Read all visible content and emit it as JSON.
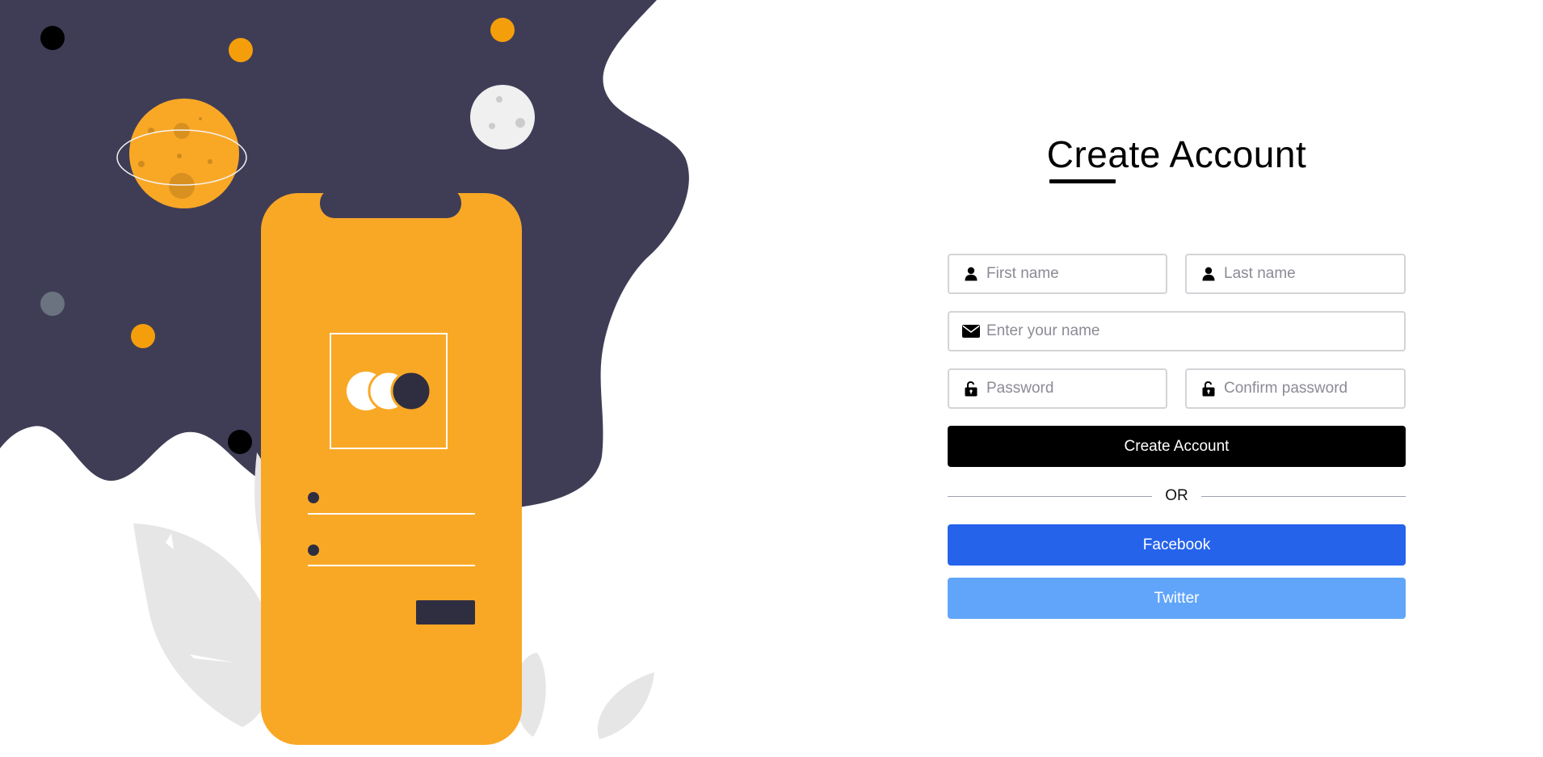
{
  "form": {
    "title": "Create Account",
    "first_name_placeholder": "First name",
    "last_name_placeholder": "Last name",
    "email_placeholder": "Enter your name",
    "password_placeholder": "Password",
    "confirm_password_placeholder": "Confirm password",
    "submit_label": "Create Account",
    "divider_text": "OR",
    "facebook_label": "Facebook",
    "twitter_label": "Twitter"
  },
  "icons": {
    "first_name": "user-icon",
    "last_name": "user-icon",
    "email": "envelope-icon",
    "password": "unlock-icon",
    "confirm_password": "unlock-icon"
  },
  "colors": {
    "accent_orange": "#f9a826",
    "dark_navy": "#3f3d56",
    "submit_bg": "#000000",
    "facebook_bg": "#2563eb",
    "twitter_bg": "#60a5fa"
  }
}
